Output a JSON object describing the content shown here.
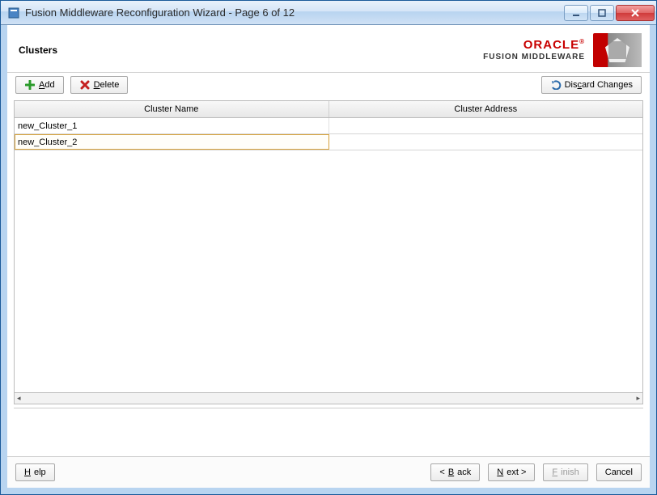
{
  "window": {
    "title": "Fusion Middleware Reconfiguration Wizard - Page 6 of 12"
  },
  "page": {
    "title": "Clusters"
  },
  "brand": {
    "oracle": "ORACLE",
    "sub": "FUSION MIDDLEWARE"
  },
  "toolbar": {
    "add_label": "Add",
    "delete_label": "Delete",
    "discard_label": "Discard Changes"
  },
  "table": {
    "columns": [
      "Cluster Name",
      "Cluster Address"
    ],
    "rows": [
      {
        "name": "new_Cluster_1",
        "address": "",
        "selected": false
      },
      {
        "name": "new_Cluster_2",
        "address": "",
        "selected": true
      }
    ]
  },
  "footer": {
    "help": "Help",
    "back": "Back",
    "next": "Next",
    "finish": "Finish",
    "cancel": "Cancel"
  }
}
